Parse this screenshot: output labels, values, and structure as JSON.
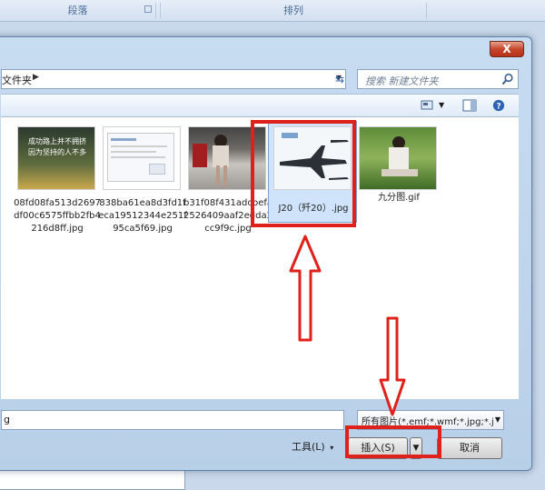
{
  "ribbon": {
    "group1": "段落",
    "group2": "排列"
  },
  "dialog": {
    "close_label": "X",
    "address_crumb": "文件夹",
    "search_placeholder": "搜索 新建文件夹"
  },
  "files": [
    {
      "name": "08fd08fa513d2697df00c6575ffbb2fb4216d8ff.jpg",
      "thumb_text": "成功路上并不拥挤\n因为坚持的人不多"
    },
    {
      "name": "838ba61ea8d3fd1feca19512344e251f95ca5f69.jpg"
    },
    {
      "name": "b31f08f431adcbefa2526409aaf2edda2cc9f9c.jpg"
    },
    {
      "name": "J20（歼20）.jpg",
      "selected": true
    },
    {
      "name": "九分图.gif"
    }
  ],
  "bottom": {
    "filename_value": "g",
    "filetype_value": "所有图片(*.emf;*.wmf;*.jpg;*.j",
    "tools_label": "工具(L)",
    "insert_label": "插入(S)",
    "cancel_label": "取消"
  },
  "colors": {
    "highlight": "#e0201a",
    "selection": "#cfe3fa"
  }
}
